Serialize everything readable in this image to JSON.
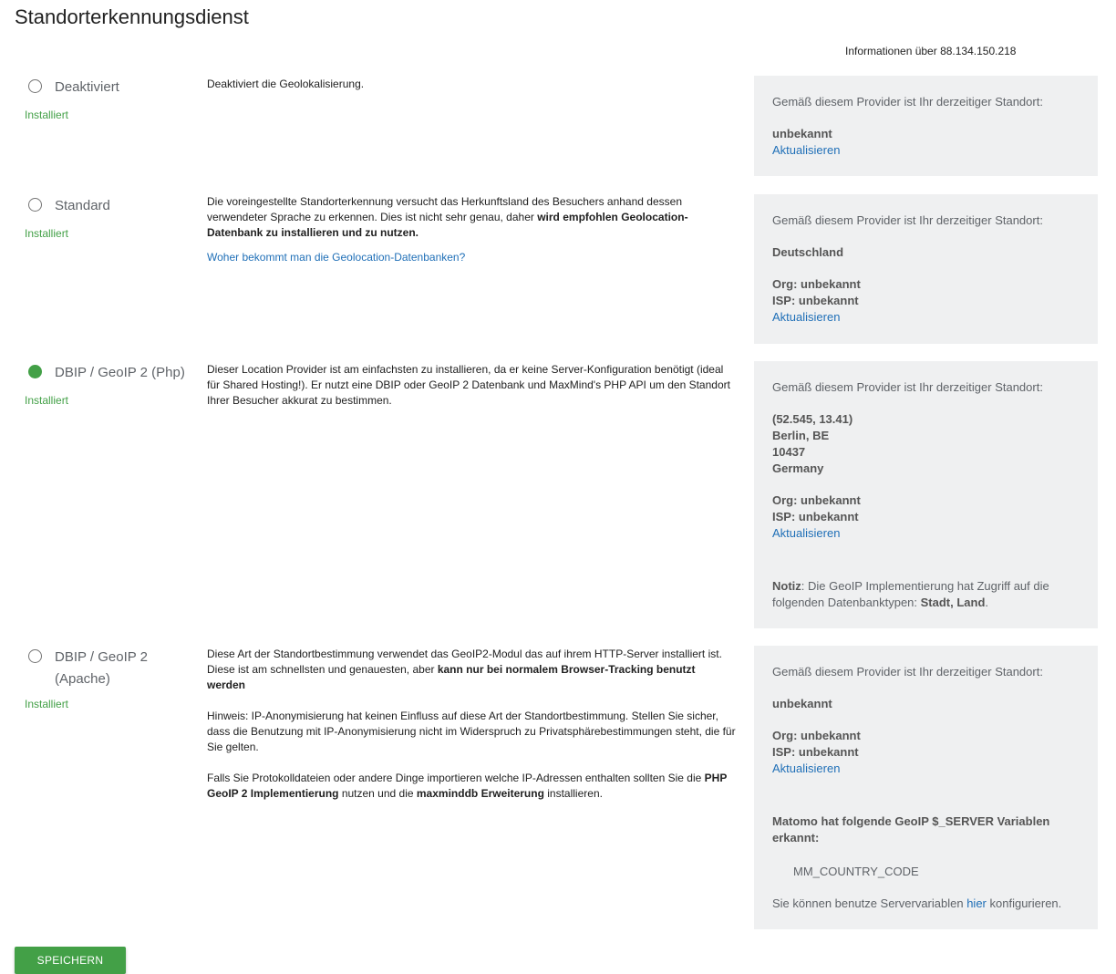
{
  "page": {
    "title": "Standorterkennungsdienst",
    "info_header": "Informationen über 88.134.150.218"
  },
  "colors": {
    "accent": "#43a047",
    "link": "#1f6fb7",
    "panel_bg": "#eff0f1"
  },
  "common": {
    "installed": "Installiert",
    "location_intro": "Gemäß diesem Provider ist Ihr derzeitiger Standort:",
    "refresh": "Aktualisieren",
    "unknown": "unbekannt",
    "org": "Org: unbekannt",
    "isp": "ISP: unbekannt"
  },
  "providers": [
    {
      "label": "Deaktiviert",
      "selected": false,
      "status": "Installiert",
      "description": "Deaktiviert die Geolokalisierung.",
      "location": "unbekannt"
    },
    {
      "label": "Standard",
      "selected": false,
      "status": "Installiert",
      "description_1": "Die voreingestellte Standorterkennung versucht das Herkunftsland des Besuchers anhand dessen verwendeter Sprache zu erkennen. Dies ist nicht sehr genau, daher ",
      "description_bold": "wird empfohlen Geolocation-Datenbank zu installieren und zu nutzen.",
      "link": "Woher bekommt man die Geolocation-Datenbanken?",
      "location": "Deutschland"
    },
    {
      "label": "DBIP / GeoIP 2 (Php)",
      "selected": true,
      "status": "Installiert",
      "description": "Dieser Location Provider ist am einfachsten zu installieren, da er keine Server-Konfiguration benötigt (ideal für Shared Hosting!). Er nutzt eine DBIP oder GeoIP 2 Datenbank und MaxMind's PHP API um den Standort Ihrer Besucher akkurat zu bestimmen.",
      "location_lines": [
        "(52.545, 13.41)",
        "Berlin, BE",
        "10437",
        "Germany"
      ],
      "note_label": "Notiz",
      "note_text": ": Die GeoIP Implementierung hat Zugriff auf die folgenden Datenbanktypen: ",
      "note_types": "Stadt, Land",
      "note_end": "."
    },
    {
      "label": "DBIP / GeoIP 2 (Apache)",
      "selected": false,
      "status": "Installiert",
      "description_1": "Diese Art der Standortbestimmung verwendet das GeoIP2-Modul das auf ihrem HTTP-Server installiert ist. Diese ist am schnellsten und genauesten, aber ",
      "description_1_bold": "kann nur bei normalem Browser-Tracking benutzt werden",
      "description_2": "Hinweis: IP-Anonymisierung hat keinen Einfluss auf diese Art der Standortbestimmung. Stellen Sie sicher, dass die Benutzung mit IP-Anonymisierung nicht im Widerspruch zu Privatsphärebestimmungen steht, die für Sie gelten.",
      "description_3a": "Falls Sie Protokolldateien oder andere Dinge importieren welche IP-Adressen enthalten sollten Sie die ",
      "description_3b": "PHP GeoIP 2 Implementierung",
      "description_3c": " nutzen und die ",
      "description_3d": "maxminddb Erweiterung",
      "description_3e": " installieren.",
      "location": "unbekannt",
      "server_vars_heading": "Matomo hat folgende GeoIP $_SERVER Variablen erkannt:",
      "server_var": "MM_COUNTRY_CODE",
      "config_text_1": "Sie können benutze Servervariablen ",
      "config_link": "hier",
      "config_text_2": " konfigurieren."
    }
  ],
  "save_button": "SPEICHERN"
}
